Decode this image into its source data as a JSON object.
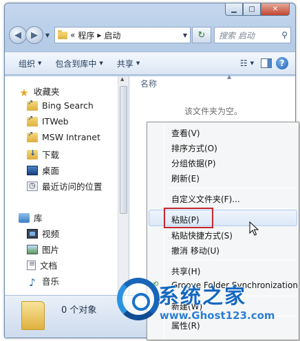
{
  "address": {
    "prefix": "«",
    "crumbs": [
      "程序",
      "启动"
    ],
    "search_placeholder": "搜索 启动"
  },
  "toolbar": {
    "organize": "组织",
    "include_in_library": "包含到库中",
    "share": "共享"
  },
  "nav": {
    "favorites": "收藏夹",
    "favorites_items": [
      "Bing Search",
      "ITWeb",
      "MSW Intranet",
      "下载",
      "桌面",
      "最近访问的位置"
    ],
    "libraries": "库",
    "library_items": [
      "视频",
      "图片",
      "文档",
      "音乐"
    ]
  },
  "content": {
    "column_name": "名称",
    "empty_message": "该文件夹为空。"
  },
  "status": {
    "item_count": "0 个对象"
  },
  "context_menu": {
    "view": "查看(V)",
    "sort": "排序方式(O)",
    "group": "分组依据(P)",
    "refresh": "刷新(E)",
    "customize": "自定义文件夹(F)...",
    "paste": "粘贴(P)",
    "paste_shortcut": "粘贴快捷方式(S)",
    "undo_move": "撤消 移动(U)",
    "share": "共享(H)",
    "groove": "Groove Folder Synchronization",
    "new": "新建(W)",
    "properties": "属性(R)"
  },
  "watermark": {
    "title": "系统之家",
    "url": "www.Ghost123.com"
  },
  "colors": {
    "highlight_border": "#c0272d",
    "watermark_blue": "#1568c0"
  }
}
